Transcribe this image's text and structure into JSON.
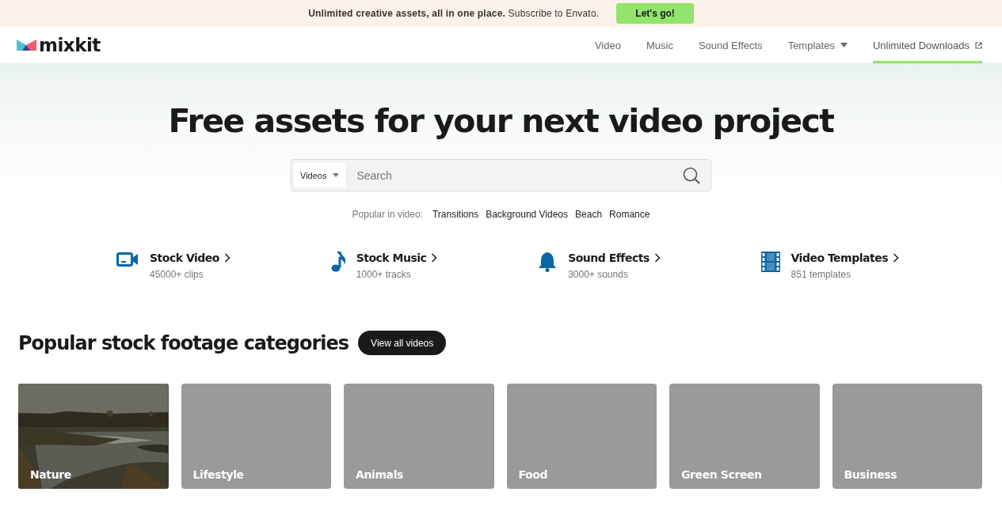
{
  "banner": {
    "text": "**Unlimited creative assets, all in one place.** Subscribe to Envato.",
    "button": "Let's go!"
  },
  "header": {
    "logo": "mixkit",
    "nav": [
      {
        "label": "Video",
        "kind": "plain",
        "selected": false
      },
      {
        "label": "Music",
        "kind": "plain",
        "selected": false
      },
      {
        "label": "Sound Effects",
        "kind": "plain",
        "selected": false
      },
      {
        "label": "Templates",
        "kind": "dropdown",
        "selected": false
      },
      {
        "label": "Unlimited Downloads",
        "kind": "external",
        "selected": true
      }
    ]
  },
  "hero": {
    "title": "Free assets for your next video project",
    "search": {
      "type": "Videos",
      "placeholder": "Search"
    },
    "popular": {
      "label": "Popular in video:",
      "links": [
        "Transitions",
        "Background Videos",
        "Beach",
        "Romance"
      ]
    }
  },
  "features": [
    {
      "kind": "video",
      "title": "Stock Video",
      "count": "45000+ clips"
    },
    {
      "kind": "music",
      "title": "Stock Music",
      "count": "1000+ tracks"
    },
    {
      "kind": "sound",
      "title": "Sound Effects",
      "count": "3000+ sounds"
    },
    {
      "kind": "template",
      "title": "Video Templates",
      "count": "851 templates"
    }
  ],
  "categories": {
    "title": "Popular stock footage categories",
    "button": "View all videos",
    "items": [
      {
        "label": "Nature",
        "kind": "picture"
      },
      {
        "label": "Lifestyle",
        "kind": "blank"
      },
      {
        "label": "Animals",
        "kind": "blank"
      },
      {
        "label": "Food",
        "kind": "blank"
      },
      {
        "label": "Green Screen",
        "kind": "blank"
      },
      {
        "label": "Business",
        "kind": "blank"
      }
    ]
  }
}
